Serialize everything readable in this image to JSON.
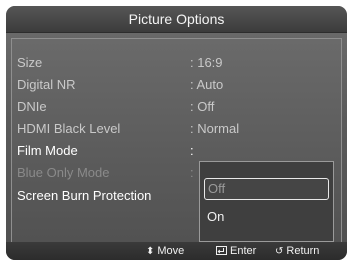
{
  "header": {
    "title": "Picture Options"
  },
  "menu": {
    "items": [
      {
        "label": "Size",
        "value": ": 16:9"
      },
      {
        "label": "Digital NR",
        "value": ": Auto"
      },
      {
        "label": "DNIe",
        "value": ": Off"
      },
      {
        "label": "HDMI Black Level",
        "value": ": Normal"
      },
      {
        "label": "Film Mode",
        "value": ":"
      },
      {
        "label": "Blue Only Mode",
        "value": ":"
      },
      {
        "label": "Screen Burn Protection",
        "value": ""
      }
    ]
  },
  "dropdown": {
    "options": [
      {
        "label": "Off"
      },
      {
        "label": "On"
      }
    ],
    "selected": "Off"
  },
  "footer": {
    "move": "Move",
    "enter": "Enter",
    "return": "Return"
  },
  "icons": {
    "move": "up-down-arrows-icon",
    "enter": "enter-icon",
    "return": "return-icon"
  }
}
